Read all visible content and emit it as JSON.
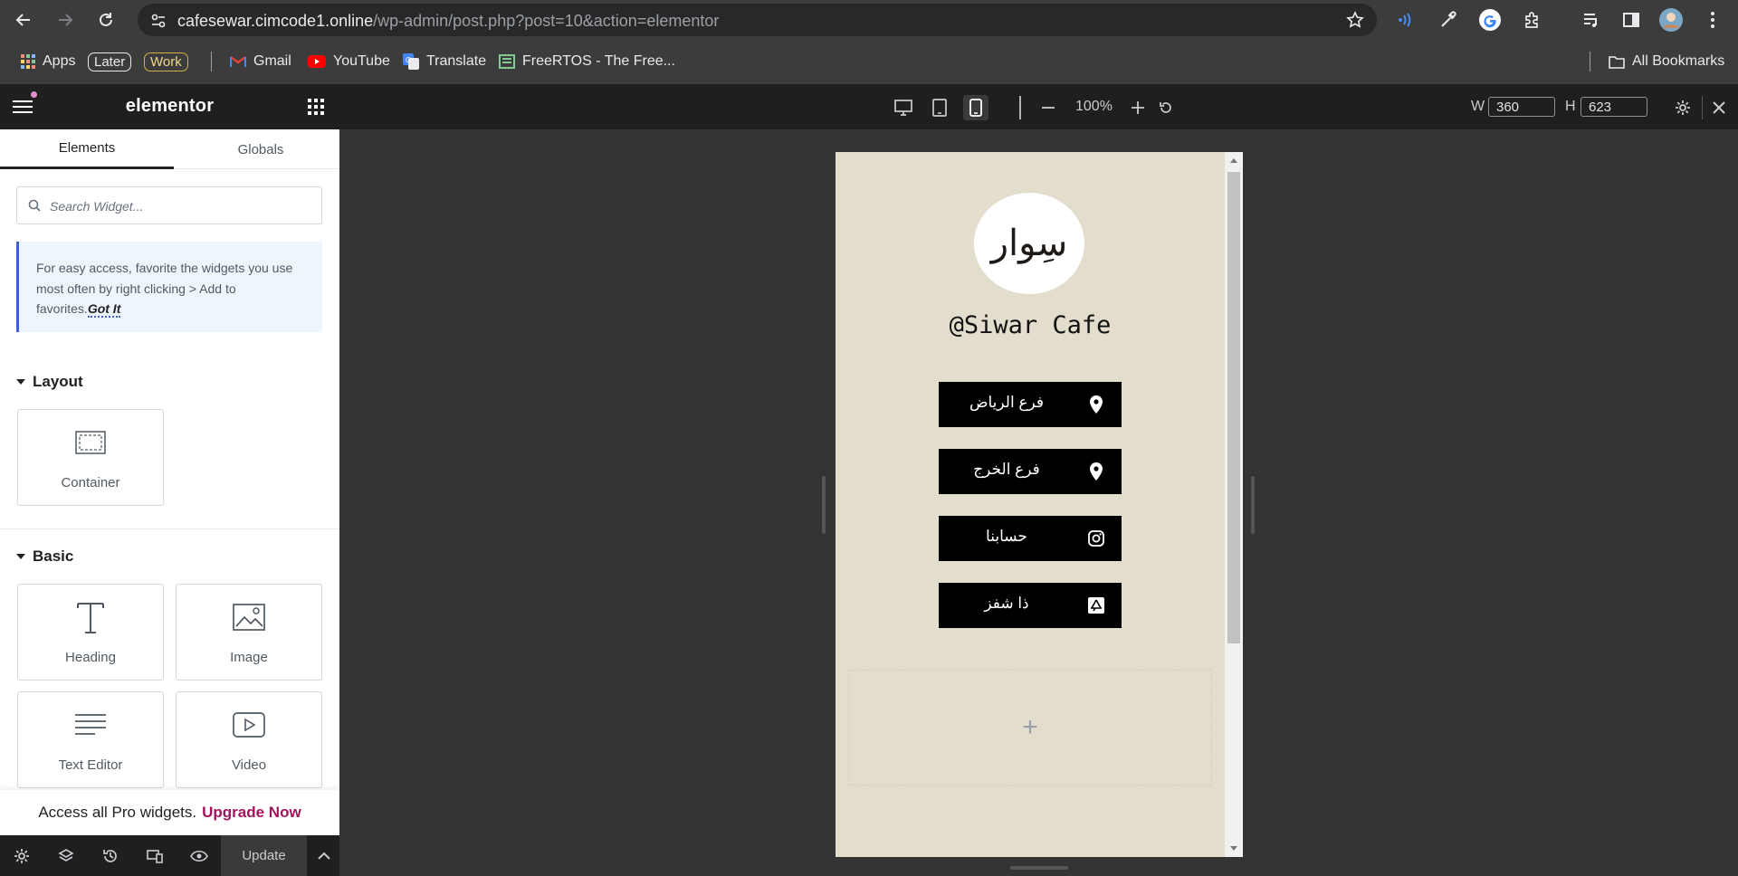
{
  "browser": {
    "url_host": "cafesewar.cimcode1.online",
    "url_path": "/wp-admin/post.php?post=10&action=elementor",
    "bookmarks": [
      {
        "label": "Apps"
      },
      {
        "label": "Later"
      },
      {
        "label": "Work"
      },
      {
        "label": "Gmail"
      },
      {
        "label": "YouTube"
      },
      {
        "label": "Translate"
      },
      {
        "label": "FreeRTOS - The Free..."
      }
    ],
    "all_bookmarks": "All Bookmarks"
  },
  "panel": {
    "logo": "elementor",
    "tabs": [
      {
        "label": "Elements",
        "active": true
      },
      {
        "label": "Globals",
        "active": false
      }
    ],
    "search_placeholder": "Search Widget...",
    "notice_text": "For easy access, favorite the widgets you use most often by right clicking > Add to favorites.",
    "notice_link": "Got It",
    "sections": {
      "layout": {
        "title": "Layout",
        "widgets": [
          {
            "label": "Container",
            "icon": "container-icon"
          }
        ]
      },
      "basic": {
        "title": "Basic",
        "widgets": [
          {
            "label": "Heading",
            "icon": "heading-icon"
          },
          {
            "label": "Image",
            "icon": "image-icon"
          },
          {
            "label": "Text Editor",
            "icon": "text-editor-icon"
          },
          {
            "label": "Video",
            "icon": "video-icon"
          }
        ]
      }
    },
    "pro_bar": {
      "text": "Access all Pro widgets.",
      "link": "Upgrade Now"
    },
    "footer": {
      "update_label": "Update"
    }
  },
  "editor_bar": {
    "zoom": "100%",
    "width_label": "W",
    "width_value": "360",
    "height_label": "H",
    "height_value": "623",
    "active_device": "mobile"
  },
  "page": {
    "logo_text": "سِوار",
    "handle": "@Siwar Cafe",
    "buttons": [
      {
        "label": "فرع الرياض",
        "icon": "map-pin-icon"
      },
      {
        "label": "فرع الخرج",
        "icon": "map-pin-icon"
      },
      {
        "label": "حسابنا",
        "icon": "instagram-icon"
      },
      {
        "label": "ذا شفز",
        "icon": "app-store-icon"
      }
    ],
    "add_section": "+"
  },
  "colors": {
    "panel_dark": "#1f1f1f",
    "page_bg": "#e3ddcd",
    "button_bg": "#000000",
    "accent_upgrade": "#a0155c",
    "notice_border": "#3b63c6"
  }
}
